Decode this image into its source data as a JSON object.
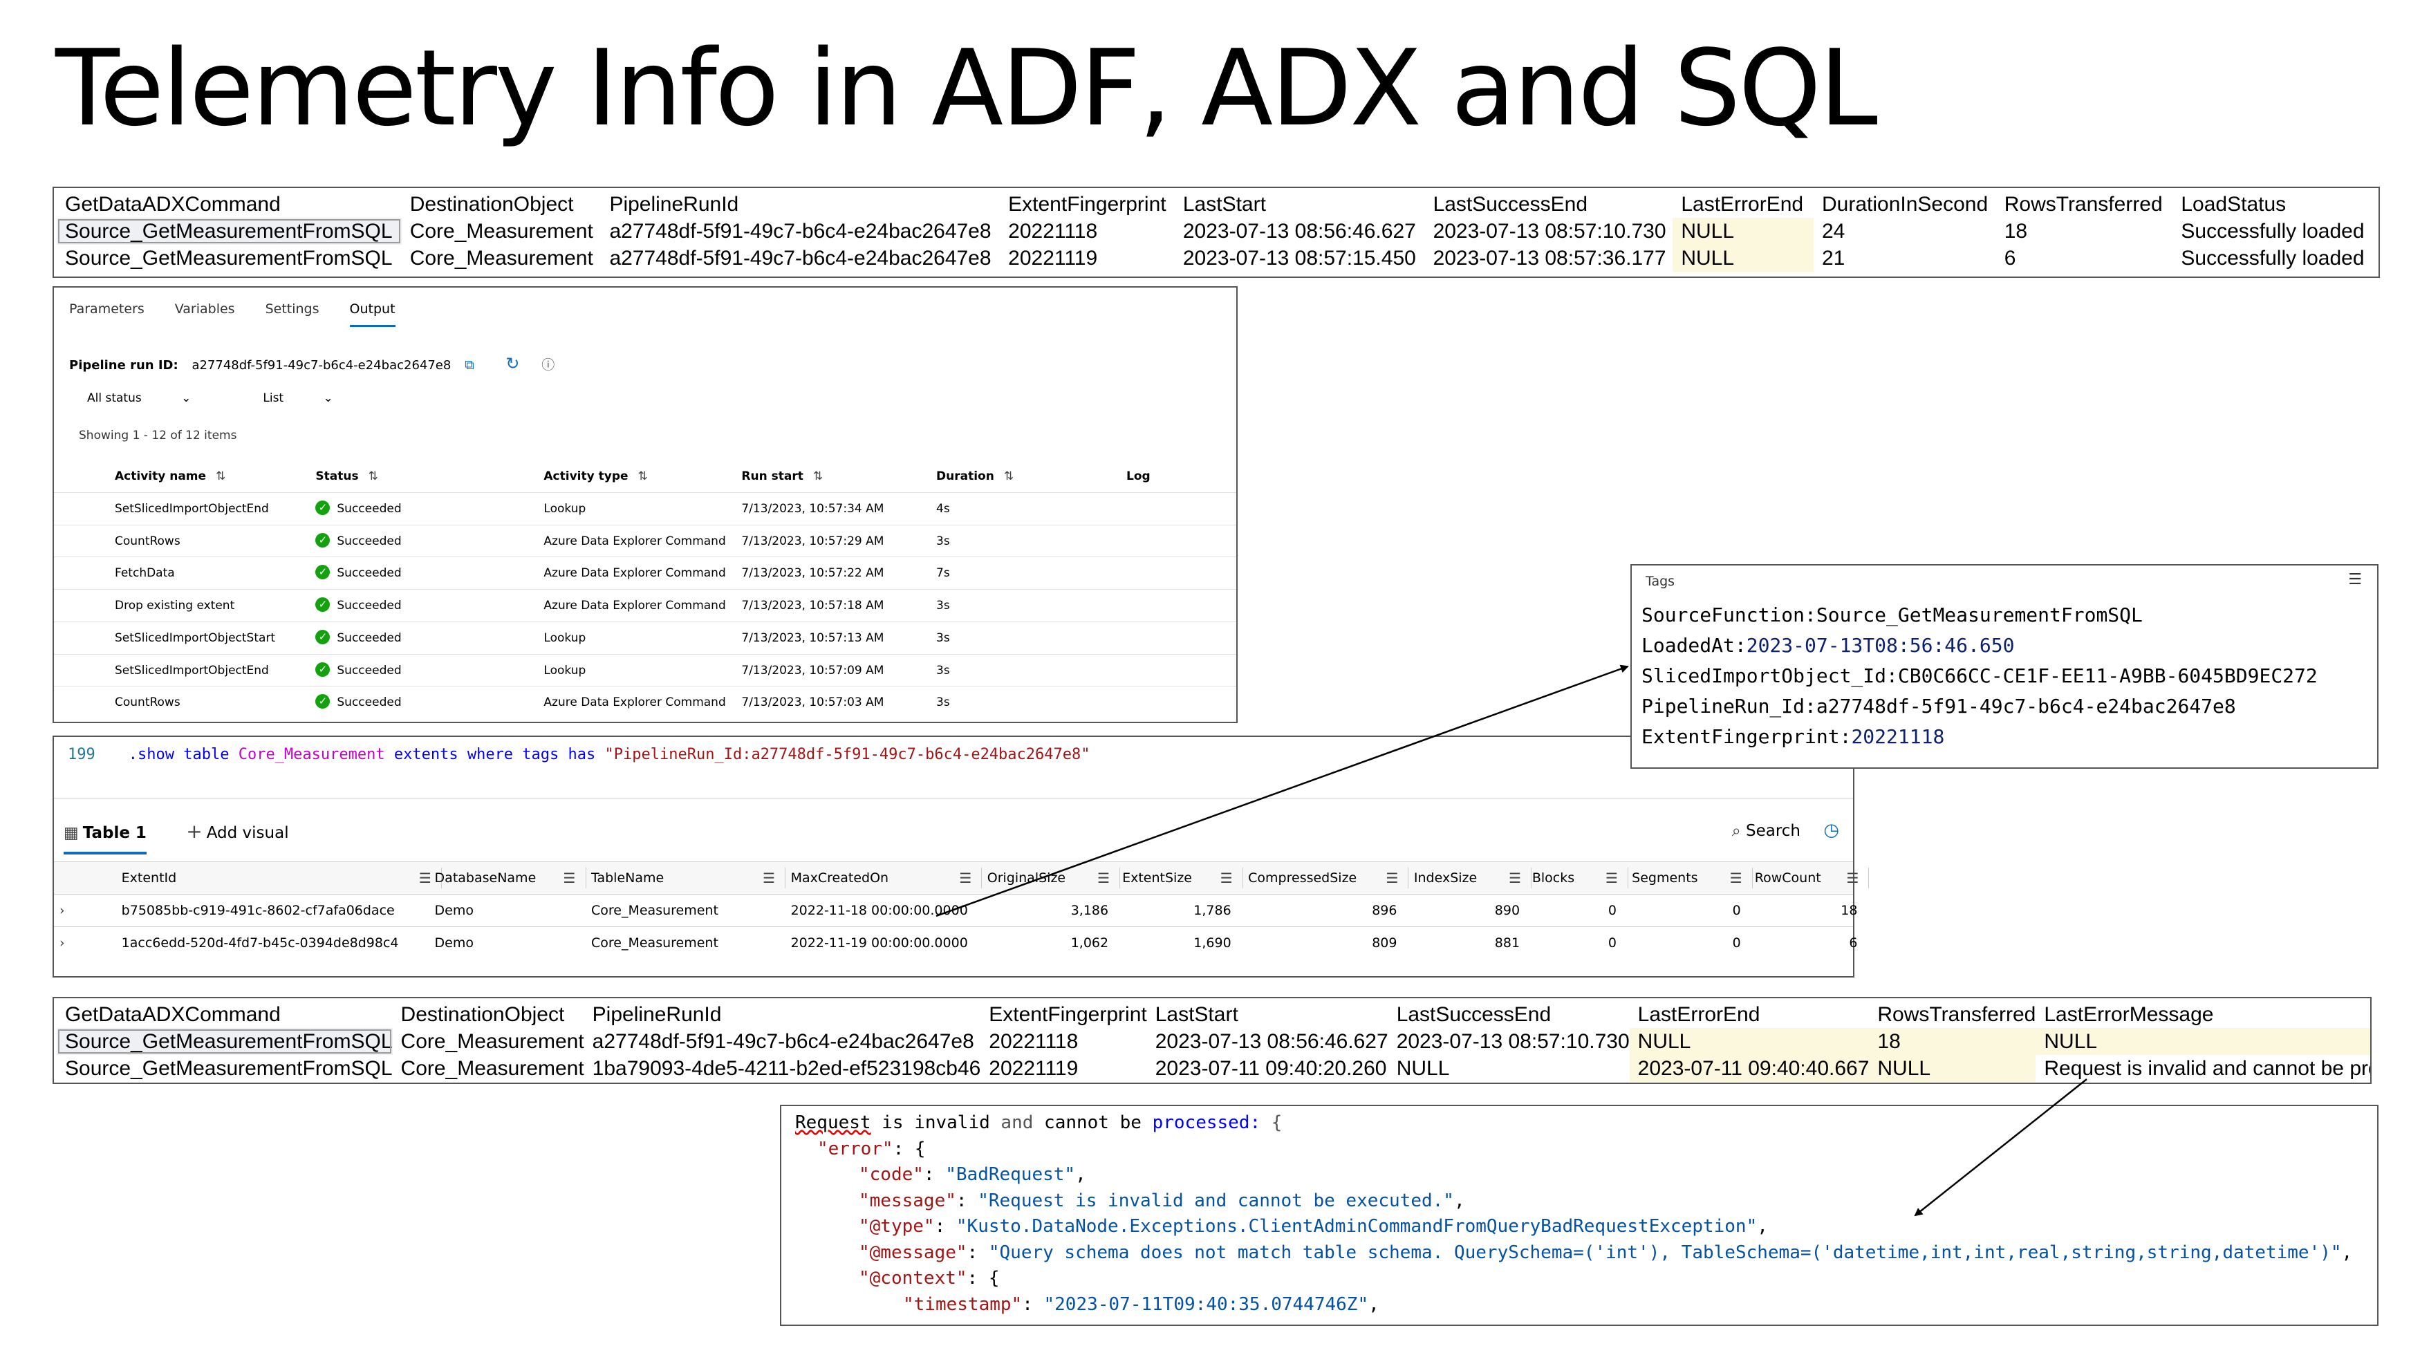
{
  "title": "Telemetry Info in ADF, ADX and SQL",
  "sql_top": {
    "columns": [
      "GetDataADXCommand",
      "DestinationObject",
      "PipelineRunId",
      "ExtentFingerprint",
      "LastStart",
      "LastSuccessEnd",
      "LastErrorEnd",
      "DurationInSecond",
      "RowsTransferred",
      "LoadStatus"
    ],
    "rows": [
      [
        "Source_GetMeasurementFromSQL",
        "Core_Measurement",
        "a27748df-5f91-49c7-b6c4-e24bac2647e8",
        "20221118",
        "2023-07-13 08:56:46.627",
        "2023-07-13 08:57:10.730",
        "NULL",
        "24",
        "18",
        "Successfully loaded"
      ],
      [
        "Source_GetMeasurementFromSQL",
        "Core_Measurement",
        "a27748df-5f91-49c7-b6c4-e24bac2647e8",
        "20221119",
        "2023-07-13 08:57:15.450",
        "2023-07-13 08:57:36.177",
        "NULL",
        "21",
        "6",
        "Successfully loaded"
      ]
    ]
  },
  "adf": {
    "tabs": [
      "Parameters",
      "Variables",
      "Settings",
      "Output"
    ],
    "active_tab": "Output",
    "run_id_label": "Pipeline run ID:",
    "run_id": "a27748df-5f91-49c7-b6c4-e24bac2647e8",
    "filters": [
      "All status",
      "List"
    ],
    "showing": "Showing 1 - 12 of 12 items",
    "columns": [
      "Activity name",
      "Status",
      "Activity type",
      "Run start",
      "Duration",
      "Log"
    ],
    "rows": [
      {
        "name": "SetSlicedImportObjectEnd",
        "status": "Succeeded",
        "type": "Lookup",
        "start": "7/13/2023, 10:57:34 AM",
        "duration": "4s"
      },
      {
        "name": "CountRows",
        "status": "Succeeded",
        "type": "Azure Data Explorer Command",
        "start": "7/13/2023, 10:57:29 AM",
        "duration": "3s"
      },
      {
        "name": "FetchData",
        "status": "Succeeded",
        "type": "Azure Data Explorer Command",
        "start": "7/13/2023, 10:57:22 AM",
        "duration": "7s"
      },
      {
        "name": "Drop existing extent",
        "status": "Succeeded",
        "type": "Azure Data Explorer Command",
        "start": "7/13/2023, 10:57:18 AM",
        "duration": "3s"
      },
      {
        "name": "SetSlicedImportObjectStart",
        "status": "Succeeded",
        "type": "Lookup",
        "start": "7/13/2023, 10:57:13 AM",
        "duration": "3s"
      },
      {
        "name": "SetSlicedImportObjectEnd",
        "status": "Succeeded",
        "type": "Lookup",
        "start": "7/13/2023, 10:57:09 AM",
        "duration": "3s"
      },
      {
        "name": "CountRows",
        "status": "Succeeded",
        "type": "Azure Data Explorer Command",
        "start": "7/13/2023, 10:57:03 AM",
        "duration": "3s"
      }
    ]
  },
  "adx": {
    "line_number": "199",
    "query": {
      "p1": ".show table ",
      "table": "Core_Measurement",
      "p2": " extents where tags  has ",
      "str": "\"PipelineRun_Id:a27748df-5f91-49c7-b6c4-e24bac2647e8\""
    },
    "tab_label": "Table 1",
    "add_visual": "Add visual",
    "search": "Search",
    "columns": [
      "ExtentId",
      "DatabaseName",
      "TableName",
      "MaxCreatedOn",
      "OriginalSize",
      "ExtentSize",
      "CompressedSize",
      "IndexSize",
      "Blocks",
      "Segments",
      "RowCount"
    ],
    "rows": [
      [
        "b75085bb-c919-491c-8602-cf7afa06dace",
        "Demo",
        "Core_Measurement",
        "2022-11-18 00:00:00.0000",
        "3,186",
        "1,786",
        "896",
        "890",
        "0",
        "0",
        "18"
      ],
      [
        "1acc6edd-520d-4fd7-b45c-0394de8d98c4",
        "Demo",
        "Core_Measurement",
        "2022-11-19 00:00:00.0000",
        "1,062",
        "1,690",
        "809",
        "881",
        "0",
        "0",
        "6"
      ]
    ]
  },
  "tags": {
    "header": "Tags",
    "lines": [
      {
        "k": "SourceFunction:",
        "v": "Source_GetMeasurementFromSQL"
      },
      {
        "k": "LoadedAt:",
        "v": "2023-07-13T08:56:46.650"
      },
      {
        "k": "SlicedImportObject_Id:",
        "v": "CB0C66CC-CE1F-EE11-A9BB-6045BD9EC272"
      },
      {
        "k": "PipelineRun_Id:",
        "v": "a27748df-5f91-49c7-b6c4-e24bac2647e8"
      },
      {
        "k": "ExtentFingerprint:",
        "v": "20221118"
      }
    ]
  },
  "sql_bottom": {
    "columns": [
      "GetDataADXCommand",
      "DestinationObject",
      "PipelineRunId",
      "ExtentFingerprint",
      "LastStart",
      "LastSuccessEnd",
      "LastErrorEnd",
      "RowsTransferred",
      "LastErrorMessage"
    ],
    "rows": [
      [
        "Source_GetMeasurementFromSQL",
        "Core_Measurement",
        "a27748df-5f91-49c7-b6c4-e24bac2647e8",
        "20221118",
        "2023-07-13 08:56:46.627",
        "2023-07-13 08:57:10.730",
        "NULL",
        "18",
        "NULL"
      ],
      [
        "Source_GetMeasurementFromSQL",
        "Core_Measurement",
        "1ba79093-4de5-4211-b2ed-ef523198cb46",
        "20221119",
        "2023-07-11 09:40:20.260",
        "NULL",
        "2023-07-11 09:40:40.667",
        "NULL",
        "Request is invalid and cannot be processed"
      ]
    ]
  },
  "error": {
    "l1_a": "Request",
    "l1_b": " is invalid ",
    "l1_c": "and",
    "l1_d": " cannot be ",
    "l1_e": "processed:",
    "l1_f": " {",
    "error_key": "\"error\"",
    "code_key": "\"code\"",
    "code_val": "\"BadRequest\"",
    "message_key": "\"message\"",
    "message_val": "\"Request is invalid and cannot be executed.\"",
    "type_key": "\"@type\"",
    "type_val": "\"Kusto.DataNode.Exceptions.ClientAdminCommandFromQueryBadRequestException\"",
    "atmessage_key": "\"@message\"",
    "atmessage_val": "\"Query schema does not match table schema. QuerySchema=('int'), TableSchema=('datetime,int,int,real,string,string,datetime')\"",
    "context_key": "\"@context\"",
    "timestamp_key": "\"timestamp\"",
    "timestamp_val": "\"2023-07-11T09:40:35.0744746Z\""
  },
  "colors": {
    "accent": "#0f6cbd",
    "success": "#13a10e",
    "null_highlight": "#fbf8dd",
    "kql_table": "#c700c7",
    "kql_string": "#a31515"
  }
}
